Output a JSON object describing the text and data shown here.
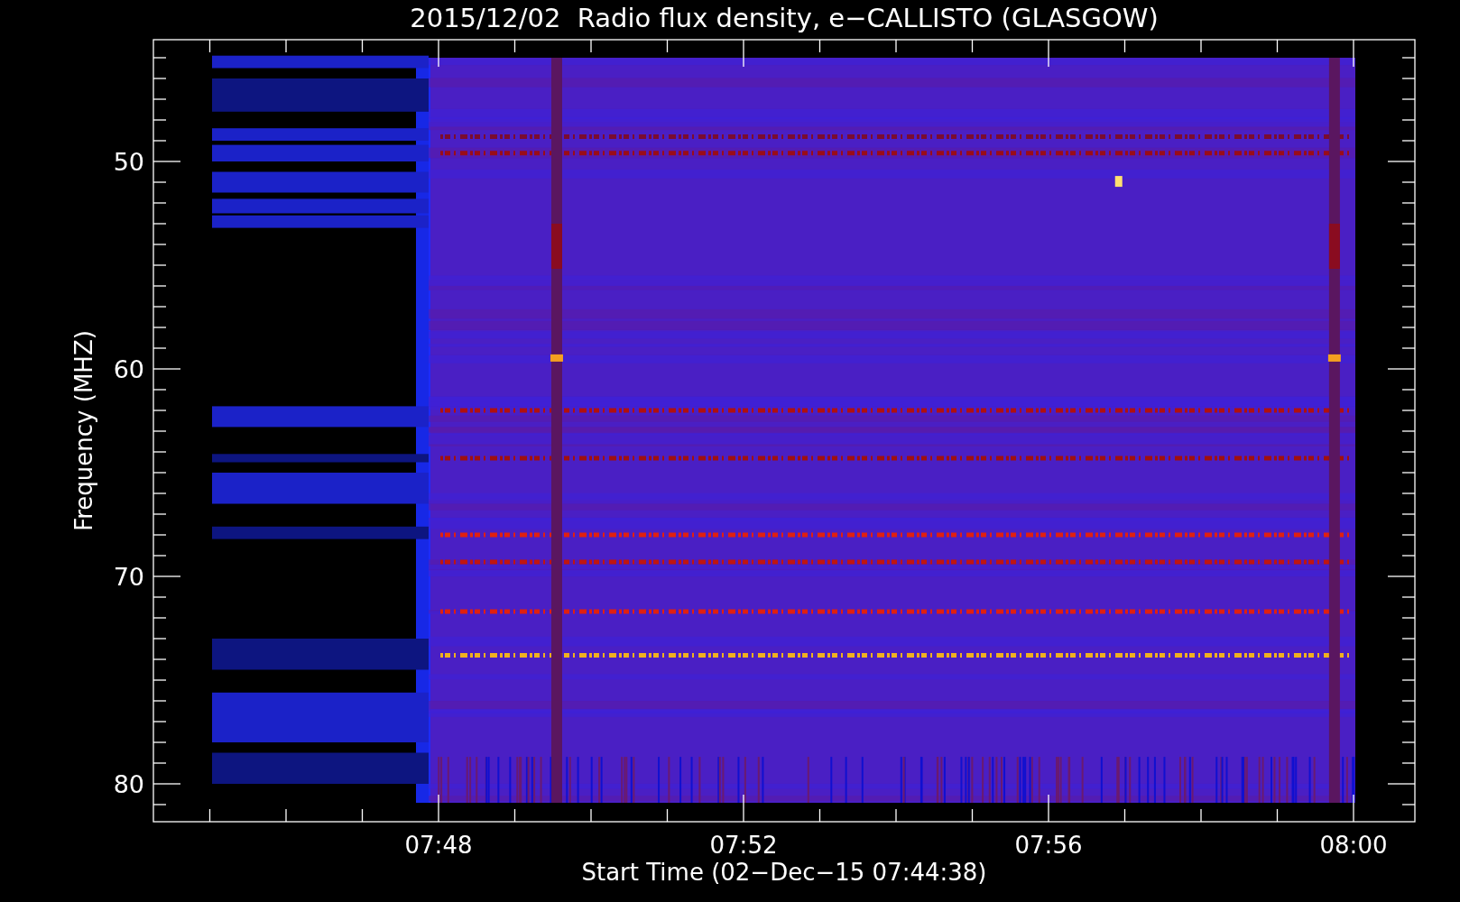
{
  "plot": {
    "title": "2015/12/02  Radio flux density, e−CALLISTO (GLASGOW)",
    "xlabel": "Start Time (02−Dec−15 07:44:38)",
    "ylabel": "Frequency (MHZ)",
    "x_tick_labels": [
      "07:48",
      "07:52",
      "07:56",
      "08:00"
    ],
    "y_tick_labels": [
      "50",
      "60",
      "70",
      "80"
    ]
  }
}
